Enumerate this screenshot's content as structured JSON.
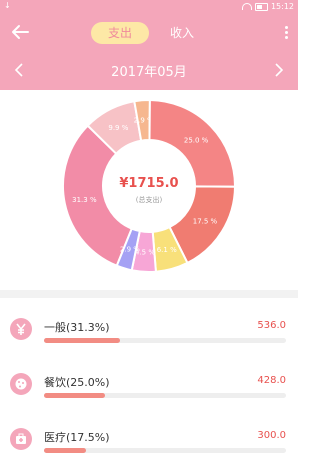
{
  "status": {
    "time": "15:12",
    "left_mark": "↓"
  },
  "header": {
    "tabs": [
      {
        "label": "支出"
      },
      {
        "label": "收入"
      }
    ],
    "date": "2017年05月"
  },
  "chart_data": {
    "type": "pie",
    "center_value": "¥1715.0",
    "center_label": "(总支出)",
    "slices": [
      {
        "label": "31.3 %",
        "value": 31.3,
        "color": "#f28ca7"
      },
      {
        "label": "9.9 %",
        "value": 9.9,
        "color": "#f7c2c6"
      },
      {
        "label": "2.9 %",
        "value": 2.9,
        "color": "#f6b78f"
      },
      {
        "label": "25.0 %",
        "value": 25.0,
        "color": "#f48585"
      },
      {
        "label": "17.5 %",
        "value": 17.5,
        "color": "#f07c71"
      },
      {
        "label": "6.1 %",
        "value": 6.1,
        "color": "#f8e07a"
      },
      {
        "label": "4.5 %",
        "value": 4.5,
        "color": "#f7a6d6"
      },
      {
        "label": "2.9 %",
        "value": 2.9,
        "color": "#a5a1f4"
      }
    ]
  },
  "categories": [
    {
      "label": "一般(31.3%)",
      "amount": "536.0",
      "fraction": 0.313,
      "icon": "yen-icon"
    },
    {
      "label": "餐饮(25.0%)",
      "amount": "428.0",
      "fraction": 0.25,
      "icon": "cookie-icon"
    },
    {
      "label": "医疗(17.5%)",
      "amount": "300.0",
      "fraction": 0.175,
      "icon": "medical-kit-icon"
    }
  ]
}
